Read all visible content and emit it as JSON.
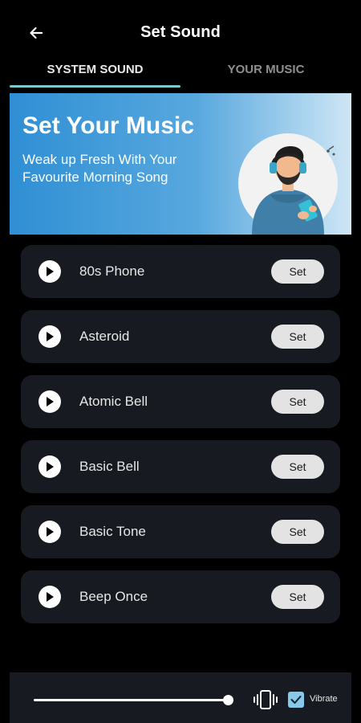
{
  "header": {
    "title": "Set Sound",
    "back_icon": "arrow-left-icon"
  },
  "tabs": [
    {
      "label": "SYSTEM SOUND",
      "selected": true
    },
    {
      "label": "YOUR MUSIC",
      "selected": false
    }
  ],
  "banner": {
    "title": "Set Your Music",
    "subtitle": "Weak up Fresh With Your Favourite Morning Song"
  },
  "sounds": [
    {
      "name": "80s Phone",
      "action": "Set"
    },
    {
      "name": "Asteroid",
      "action": "Set"
    },
    {
      "name": "Atomic Bell",
      "action": "Set"
    },
    {
      "name": "Basic Bell",
      "action": "Set"
    },
    {
      "name": "Basic Tone",
      "action": "Set"
    },
    {
      "name": "Beep Once",
      "action": "Set"
    }
  ],
  "bottom": {
    "volume_fraction": 1.0,
    "vibrate_label": "Vibrate",
    "vibrate_checked": true
  },
  "colors": {
    "accent": "#7fc9cc",
    "row_bg": "#171b21",
    "banner_blue": "#2f8fd4",
    "checkbox": "#86c9e9"
  }
}
